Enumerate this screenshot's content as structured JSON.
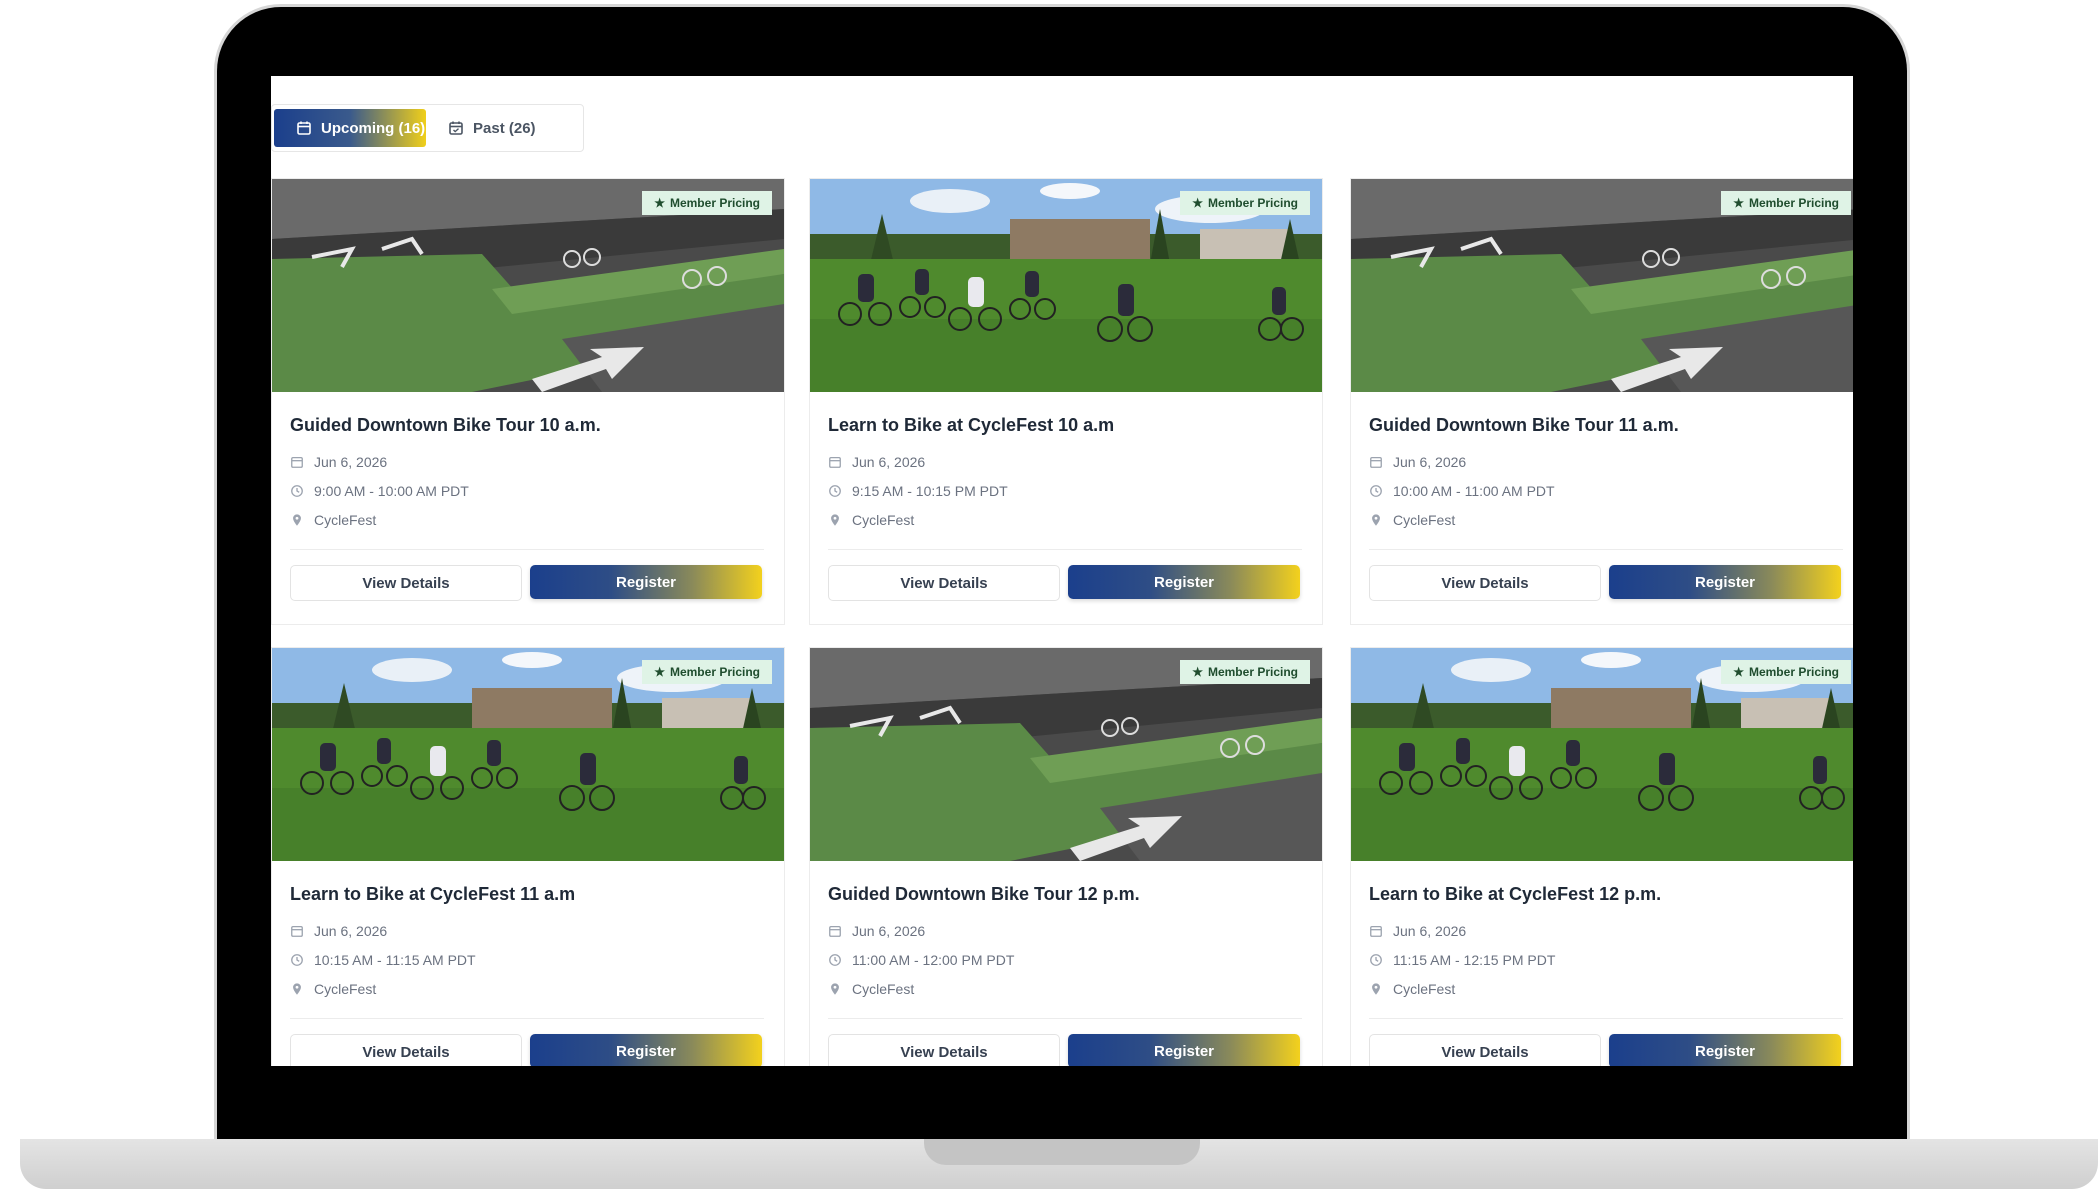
{
  "tabs": [
    {
      "label": "Upcoming (16)",
      "active": true,
      "icon": "calendar-icon"
    },
    {
      "label": "Past (26)",
      "active": false,
      "icon": "calendar-check-icon"
    }
  ],
  "badge_label": "Member Pricing",
  "events": [
    {
      "title": "Guided Downtown Bike Tour 10 a.m.",
      "date": "Jun 6, 2026",
      "time": "9:00 AM - 10:00 AM PDT",
      "location": "CycleFest",
      "image": "bike-lane-photo",
      "details_label": "View Details",
      "register_label": "Register"
    },
    {
      "title": "Learn to Bike at CycleFest 10 a.m",
      "date": "Jun 6, 2026",
      "time": "9:15 AM - 10:15 PM PDT",
      "location": "CycleFest",
      "image": "riders-field-photo",
      "details_label": "View Details",
      "register_label": "Register"
    },
    {
      "title": "Guided Downtown Bike Tour 11 a.m.",
      "date": "Jun 6, 2026",
      "time": "10:00 AM - 11:00 AM PDT",
      "location": "CycleFest",
      "image": "bike-lane-photo",
      "details_label": "View Details",
      "register_label": "Register"
    },
    {
      "title": "Learn to Bike at CycleFest 11 a.m",
      "date": "Jun 6, 2026",
      "time": "10:15 AM - 11:15 AM PDT",
      "location": "CycleFest",
      "image": "riders-field-photo",
      "details_label": "View Details",
      "register_label": "Register"
    },
    {
      "title": "Guided Downtown Bike Tour 12 p.m.",
      "date": "Jun 6, 2026",
      "time": "11:00 AM - 12:00 PM PDT",
      "location": "CycleFest",
      "image": "bike-lane-photo",
      "details_label": "View Details",
      "register_label": "Register"
    },
    {
      "title": "Learn to Bike at CycleFest 12 p.m.",
      "date": "Jun 6, 2026",
      "time": "11:15 AM - 12:15 PM PDT",
      "location": "CycleFest",
      "image": "riders-field-photo",
      "details_label": "View Details",
      "register_label": "Register"
    }
  ],
  "colors": {
    "brand_blue": "#1b3f8c",
    "brand_yellow": "#f3d11d",
    "badge_bg": "#dff3e6",
    "badge_text": "#1f4d2e"
  }
}
